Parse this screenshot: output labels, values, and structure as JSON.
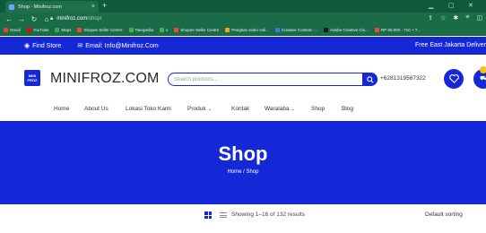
{
  "browser": {
    "tab_title": "Shop - Minifroz.com",
    "tab_close": "×",
    "new_tab": "+",
    "url_host": "minifroz.com",
    "url_path": "/shop/",
    "bookmarks": [
      {
        "label": "Gmail",
        "color": "#ea4335"
      },
      {
        "label": "YouTube",
        "color": "#ff0000"
      },
      {
        "label": "Maps",
        "color": "#34a853"
      },
      {
        "label": "Shopee Seller Centre",
        "color": "#ee4d2d"
      },
      {
        "label": "Tokopedia",
        "color": "#42b549"
      },
      {
        "label": "s",
        "color": "#42b549"
      },
      {
        "label": "Shopee Seller Centre",
        "color": "#ee4d2d"
      },
      {
        "label": "Pengkas video onli...",
        "color": "#f5a623"
      },
      {
        "label": "Creative Content -...",
        "color": "#3c7bd9"
      },
      {
        "label": "Adobe Creative Clo...",
        "color": "#1a1a1a"
      },
      {
        "label": "RP 80.000 - 710 + ?...",
        "color": "#e84c3d"
      }
    ]
  },
  "topbar": {
    "find_store": "Find Store",
    "email": "Email: Info@Minifroz.Com",
    "shipping": "Free East Jakarta Deliver"
  },
  "header": {
    "logo_box": "MINI FROZ",
    "logo_text": "MINIFROZ.COM",
    "search_placeholder": "Search products...",
    "phone": "+6281319567322"
  },
  "nav": {
    "items": [
      {
        "label": "Home"
      },
      {
        "label": "About Us"
      },
      {
        "label": "Lokasi Toko Kami"
      },
      {
        "label": "Produk"
      },
      {
        "label": "Kontak"
      },
      {
        "label": "Waralaba"
      },
      {
        "label": "Shop"
      },
      {
        "label": "Blog"
      }
    ]
  },
  "hero": {
    "title": "Shop",
    "breadcrumb": "Home / Shop"
  },
  "toolbar": {
    "result_count": "Showing 1–16 of 132 results",
    "sorting": "Default sorting"
  },
  "colors": {
    "brand_blue": "#1428d8",
    "chrome_green": "#1a6b48"
  }
}
